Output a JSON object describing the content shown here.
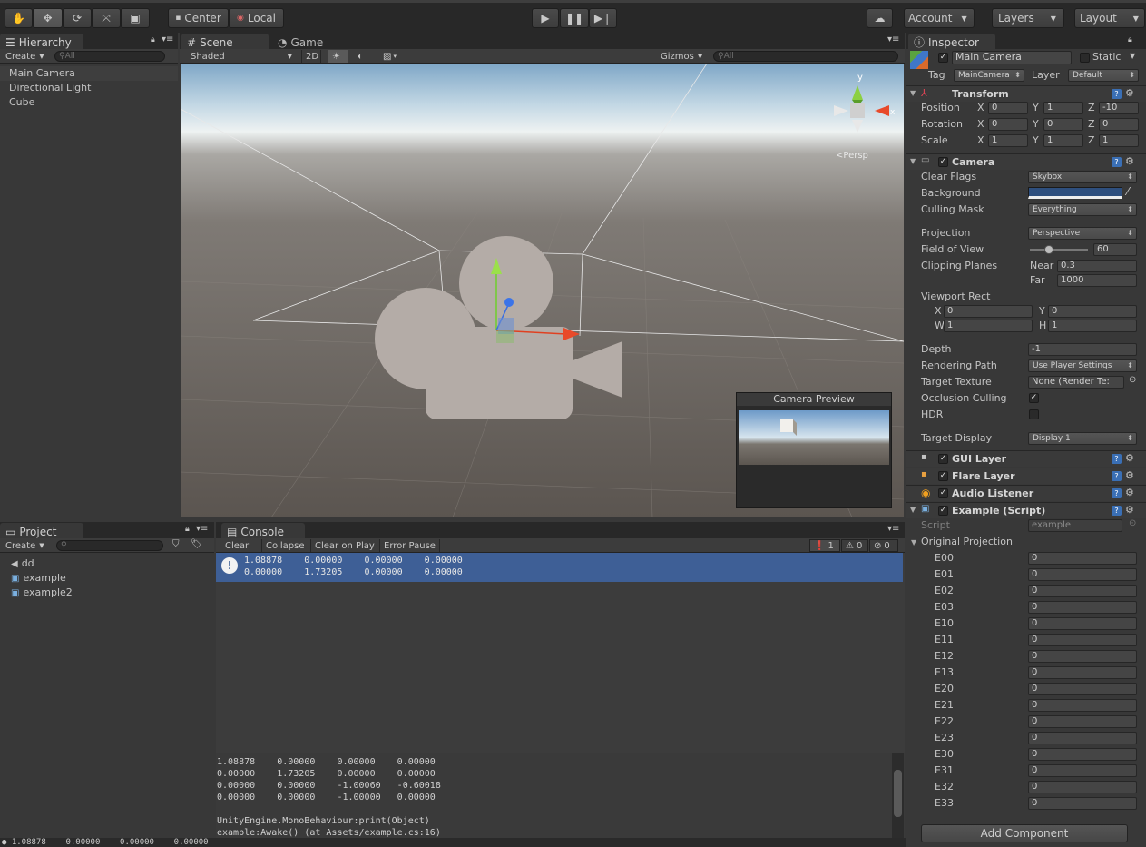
{
  "toolbar": {
    "pivot": "Center",
    "space": "Local",
    "account": "Account",
    "layers": "Layers",
    "layout": "Layout"
  },
  "hierarchy": {
    "tab": "Hierarchy",
    "create": "Create",
    "search_placeholder": "All",
    "items": [
      "Main Camera",
      "Directional Light",
      "Cube"
    ]
  },
  "scene": {
    "tab_scene": "Scene",
    "tab_game": "Game",
    "shading": "Shaded",
    "mode2d": "2D",
    "gizmos": "Gizmos",
    "search_placeholder": "All",
    "persp_label": "Persp",
    "gizmo_y": "y",
    "gizmo_x": "x",
    "camera_preview_title": "Camera Preview"
  },
  "project": {
    "tab": "Project",
    "create": "Create",
    "items": [
      "dd",
      "example",
      "example2"
    ]
  },
  "console": {
    "tab": "Console",
    "buttons": [
      "Clear",
      "Collapse",
      "Clear on Play",
      "Error Pause"
    ],
    "counts": {
      "info": "1",
      "warn": "0",
      "error": "0"
    },
    "entry_line1": "1.08878    0.00000    0.00000    0.00000",
    "entry_line2": "0.00000    1.73205    0.00000    0.00000",
    "detail": [
      "1.08878    0.00000    0.00000    0.00000",
      "0.00000    1.73205    0.00000    0.00000",
      "0.00000    0.00000    -1.00060   -0.60018",
      "0.00000    0.00000    -1.00000   0.00000",
      "",
      "UnityEngine.MonoBehaviour:print(Object)",
      "example:Awake() (at Assets/example.cs:16)"
    ],
    "status_bar": "1.08878    0.00000    0.00000    0.00000"
  },
  "inspector": {
    "tab": "Inspector",
    "object_name": "Main Camera",
    "static_label": "Static",
    "tag_label": "Tag",
    "tag_value": "MainCamera",
    "layer_label": "Layer",
    "layer_value": "Default",
    "transform": {
      "title": "Transform",
      "rows": [
        {
          "label": "Position",
          "x": "0",
          "y": "1",
          "z": "-10"
        },
        {
          "label": "Rotation",
          "x": "0",
          "y": "0",
          "z": "0"
        },
        {
          "label": "Scale",
          "x": "1",
          "y": "1",
          "z": "1"
        }
      ]
    },
    "camera": {
      "title": "Camera",
      "clear_flags_label": "Clear Flags",
      "clear_flags": "Skybox",
      "background_label": "Background",
      "background_color": "#2e4f7e",
      "culling_mask_label": "Culling Mask",
      "culling_mask": "Everything",
      "projection_label": "Projection",
      "projection": "Perspective",
      "fov_label": "Field of View",
      "fov": "60",
      "fov_slider_fraction": 0.33,
      "clipping_label": "Clipping Planes",
      "near_label": "Near",
      "near": "0.3",
      "far_label": "Far",
      "far": "1000",
      "viewport_label": "Viewport Rect",
      "vx": "0",
      "vy": "0",
      "vw": "1",
      "vh": "1",
      "depth_label": "Depth",
      "depth": "-1",
      "rendering_path_label": "Rendering Path",
      "rendering_path": "Use Player Settings",
      "target_texture_label": "Target Texture",
      "target_texture": "None (Render Te:",
      "occlusion_label": "Occlusion Culling",
      "occlusion": true,
      "hdr_label": "HDR",
      "hdr": false,
      "target_display_label": "Target Display",
      "target_display": "Display 1"
    },
    "components": [
      "GUI Layer",
      "Flare Layer",
      "Audio Listener",
      "Example (Script)"
    ],
    "script_label": "Script",
    "script_value": "example",
    "original_projection_label": "Original Projection",
    "matrix": [
      {
        "k": "E00",
        "v": "0"
      },
      {
        "k": "E01",
        "v": "0"
      },
      {
        "k": "E02",
        "v": "0"
      },
      {
        "k": "E03",
        "v": "0"
      },
      {
        "k": "E10",
        "v": "0"
      },
      {
        "k": "E11",
        "v": "0"
      },
      {
        "k": "E12",
        "v": "0"
      },
      {
        "k": "E13",
        "v": "0"
      },
      {
        "k": "E20",
        "v": "0"
      },
      {
        "k": "E21",
        "v": "0"
      },
      {
        "k": "E22",
        "v": "0"
      },
      {
        "k": "E23",
        "v": "0"
      },
      {
        "k": "E30",
        "v": "0"
      },
      {
        "k": "E31",
        "v": "0"
      },
      {
        "k": "E32",
        "v": "0"
      },
      {
        "k": "E33",
        "v": "0"
      }
    ],
    "add_component": "Add Component"
  }
}
